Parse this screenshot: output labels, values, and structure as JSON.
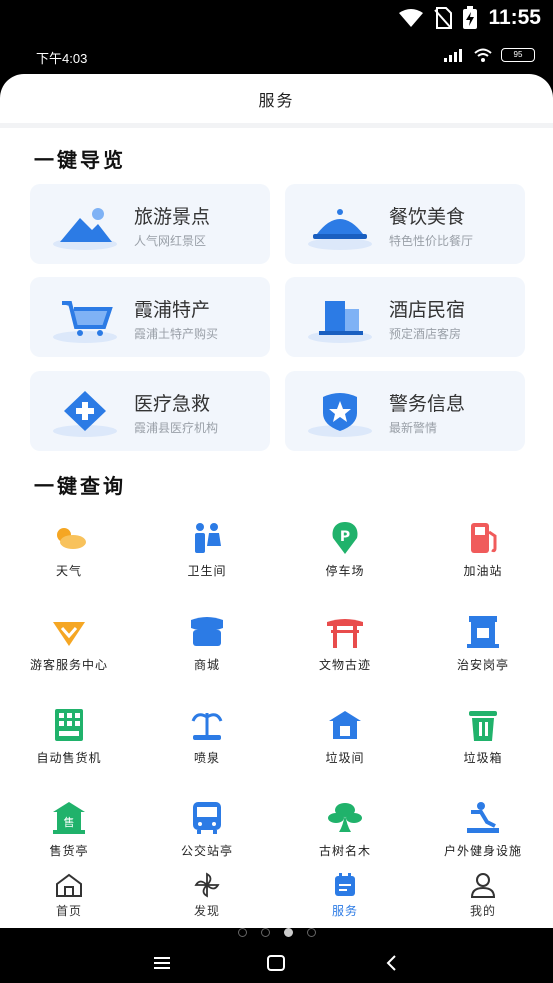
{
  "system": {
    "time": "11:55"
  },
  "inner_status": {
    "time": "下午4:03",
    "battery": "95"
  },
  "header": {
    "title": "服务"
  },
  "guide": {
    "title": "一键导览",
    "cards": [
      {
        "title": "旅游景点",
        "subtitle": "人气网红景区",
        "icon": "mountain-icon"
      },
      {
        "title": "餐饮美食",
        "subtitle": "特色性价比餐厅",
        "icon": "food-cloche-icon"
      },
      {
        "title": "霞浦特产",
        "subtitle": "霞浦土特产购买",
        "icon": "shopping-cart-icon"
      },
      {
        "title": "酒店民宿",
        "subtitle": "预定酒店客房",
        "icon": "hotel-building-icon"
      },
      {
        "title": "医疗急救",
        "subtitle": "霞浦县医疗机构",
        "icon": "medical-cross-icon"
      },
      {
        "title": "警务信息",
        "subtitle": "最新警情",
        "icon": "police-shield-icon"
      }
    ]
  },
  "query": {
    "title": "一键查询",
    "items": [
      {
        "label": "天气",
        "icon": "weather-icon"
      },
      {
        "label": "卫生间",
        "icon": "restroom-icon"
      },
      {
        "label": "停车场",
        "icon": "parking-icon"
      },
      {
        "label": "加油站",
        "icon": "gas-station-icon"
      },
      {
        "label": "游客服务中心",
        "icon": "visitor-center-icon"
      },
      {
        "label": "商城",
        "icon": "store-icon"
      },
      {
        "label": "文物古迹",
        "icon": "heritage-gate-icon"
      },
      {
        "label": "治安岗亭",
        "icon": "guard-booth-icon"
      },
      {
        "label": "自动售货机",
        "icon": "vending-machine-icon"
      },
      {
        "label": "喷泉",
        "icon": "fountain-icon"
      },
      {
        "label": "垃圾间",
        "icon": "garbage-room-icon"
      },
      {
        "label": "垃圾箱",
        "icon": "trash-bin-icon"
      },
      {
        "label": "售货亭",
        "icon": "kiosk-icon"
      },
      {
        "label": "公交站亭",
        "icon": "bus-icon"
      },
      {
        "label": "古树名木",
        "icon": "ancient-tree-icon"
      },
      {
        "label": "户外健身设施",
        "icon": "fitness-icon"
      }
    ]
  },
  "tabs": [
    {
      "label": "首页",
      "icon": "home-icon"
    },
    {
      "label": "发现",
      "icon": "pinwheel-icon"
    },
    {
      "label": "服务",
      "icon": "service-calendar-icon",
      "active": true
    },
    {
      "label": "我的",
      "icon": "user-icon"
    }
  ],
  "colors": {
    "accent": "#2c7be5",
    "card_bg": "#f2f6fc",
    "subtitle": "#9aa0a8"
  }
}
